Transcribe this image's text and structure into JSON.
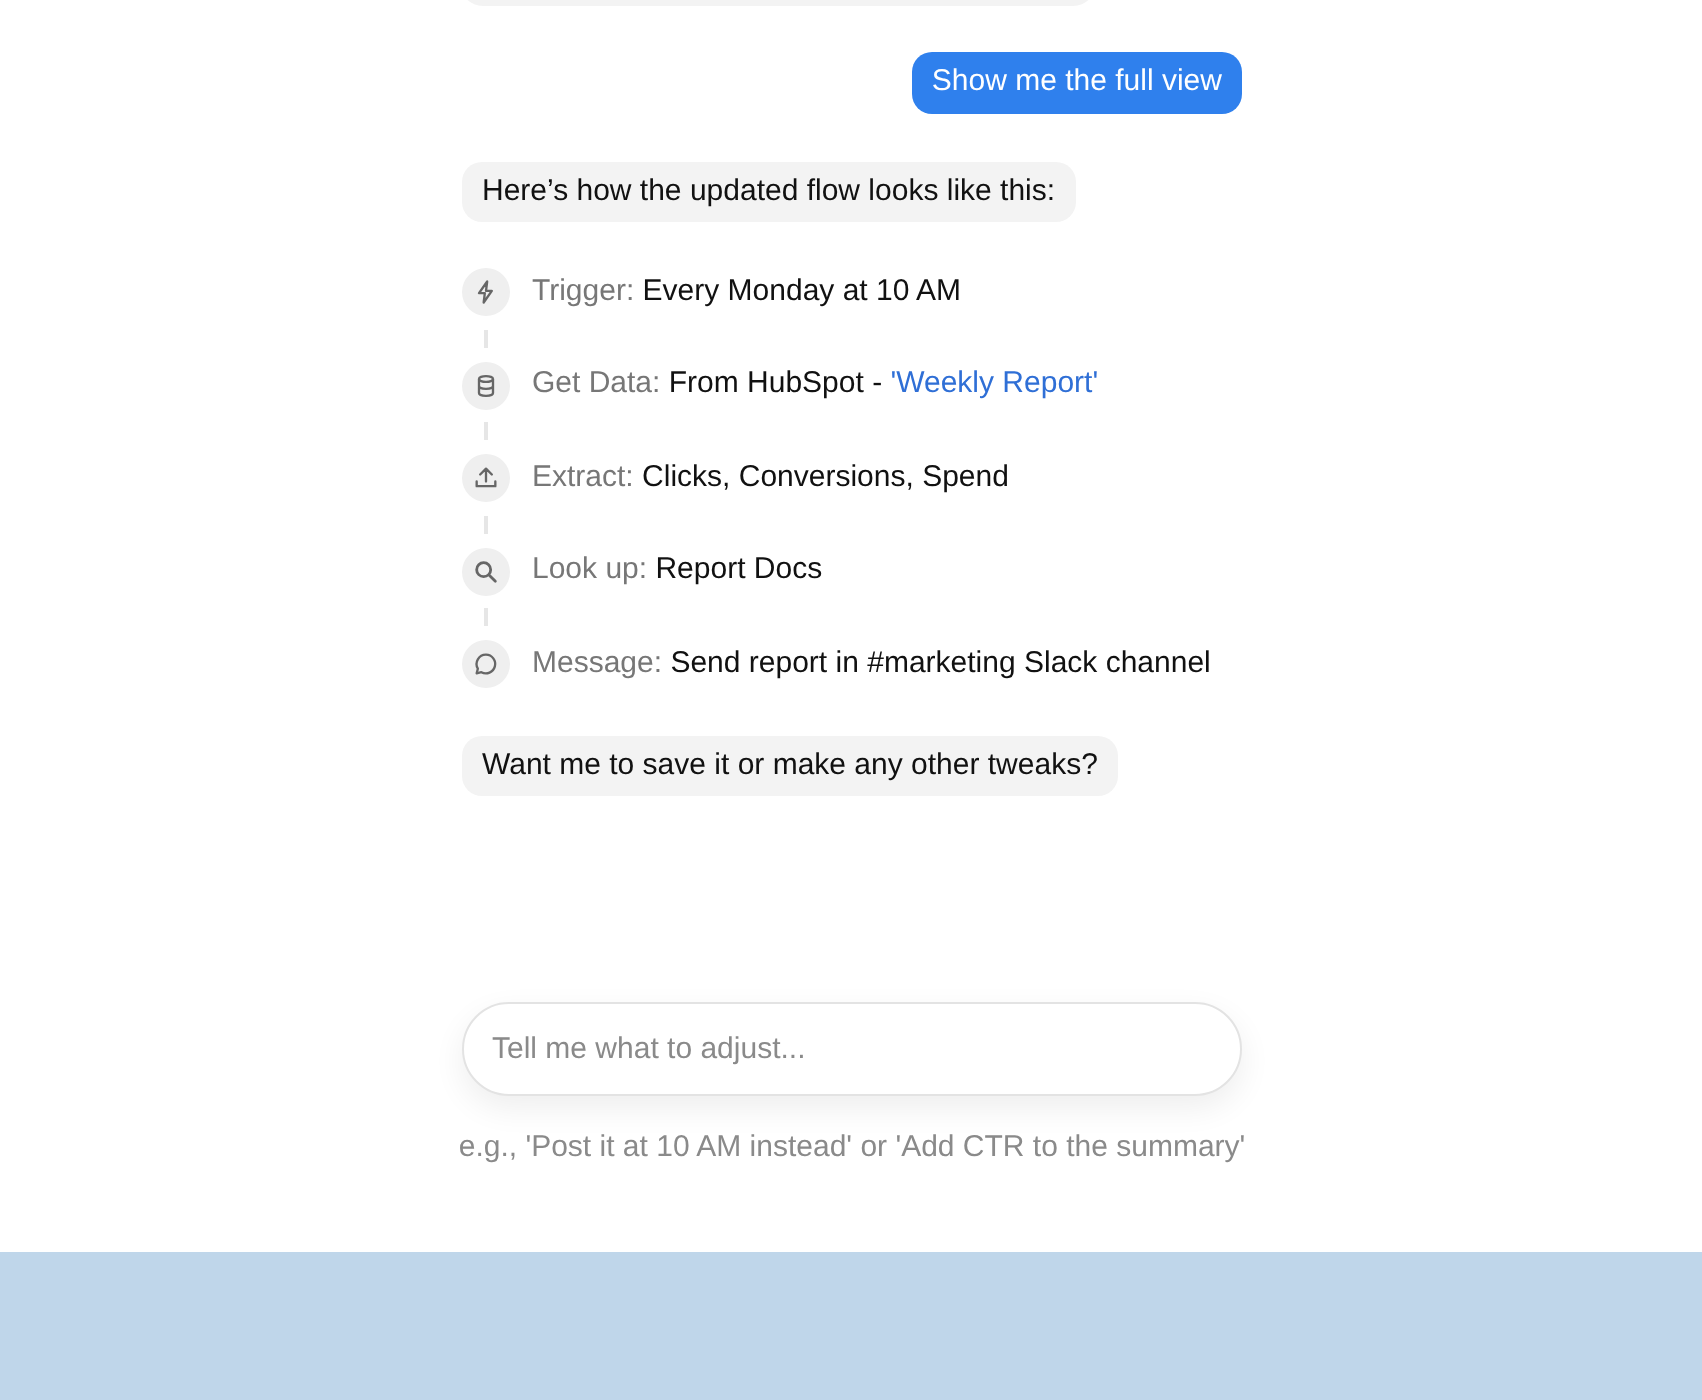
{
  "messages_top": [
    {
      "kind": "user",
      "text": "Show me the full view"
    },
    {
      "kind": "assistant",
      "text": "Here’s how the updated flow looks like this:"
    }
  ],
  "flow_steps": [
    {
      "kind": "trigger",
      "label": "Trigger:",
      "value": "Every Monday at 10 AM"
    },
    {
      "kind": "data",
      "label": "Get Data:",
      "value": "From HubSpot - ",
      "link": "'Weekly Report'"
    },
    {
      "kind": "extract",
      "label": "Extract:",
      "value": "Clicks, Conversions, Spend"
    },
    {
      "kind": "lookup",
      "label": "Look up:",
      "value": "Report Docs"
    },
    {
      "kind": "message",
      "label": "Message:",
      "value": "Send report in #marketing Slack channel"
    }
  ],
  "messages_bottom": [
    {
      "kind": "assistant",
      "text": "Want me to save it or make any other tweaks?"
    }
  ],
  "composer": {
    "placeholder": "Tell me what to adjust...",
    "hint": "e.g., 'Post it at 10 AM instead' or 'Add CTR to the summary'"
  }
}
